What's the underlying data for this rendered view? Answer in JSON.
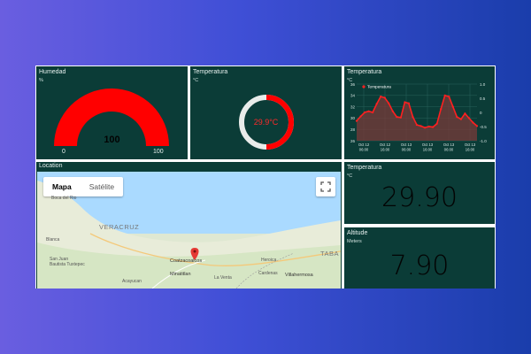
{
  "humedad": {
    "title": "Humedad",
    "unit": "%",
    "value": "100",
    "min": "0",
    "max": "100",
    "fraction": 1.0,
    "color": "#ff0000"
  },
  "temperatura_donut": {
    "title": "Temperatura",
    "unit": "°C",
    "value_text": "29.9°C",
    "fraction": 0.5,
    "color": "#ff0000"
  },
  "temperatura_chart": {
    "title": "Temperatura",
    "unit": "°C",
    "legend": "Temperatura"
  },
  "chart_data": {
    "type": "line",
    "title": "Temperatura",
    "ylabel": "°C",
    "series": [
      {
        "name": "Temperatura",
        "x": [
          0,
          0.3,
          0.6,
          0.9,
          1.2,
          1.5,
          1.8,
          2.1,
          2.4,
          2.7,
          3.0,
          3.3,
          3.6,
          3.9,
          4.2,
          4.5,
          4.8,
          5.1,
          5.4,
          5.7,
          6.0,
          6.3,
          6.6,
          6.9,
          7.2,
          7.5,
          7.8,
          8.1,
          8.4,
          8.7,
          9.0
        ],
        "values": [
          29.5,
          30.3,
          31.0,
          31.2,
          31.0,
          32.5,
          33.8,
          33.6,
          32.6,
          31.2,
          30.2,
          30.1,
          32.8,
          32.6,
          30.2,
          28.8,
          28.6,
          28.3,
          28.5,
          28.4,
          29.0,
          31.6,
          34.0,
          33.8,
          32.0,
          30.2,
          29.8,
          30.8,
          30.0,
          29.2,
          28.6
        ],
        "color": "#ff2020"
      }
    ],
    "categories": [
      "Oct 12\n06:00",
      "Oct 12\n16:00",
      "Oct 13\n06:00",
      "Oct 13\n16:00",
      "Oct 13\n06:00",
      "Oct 13\n16:00"
    ],
    "y_ticks": [
      "26",
      "28",
      "30",
      "32",
      "34",
      "36"
    ],
    "y_right_ticks": [
      "1.0",
      "0.5",
      "0",
      "-0.5",
      "-1.0"
    ],
    "ylim": [
      26,
      36
    ],
    "grid": true,
    "legend_position": "top-left"
  },
  "location": {
    "title": "Location",
    "map_tab": "Mapa",
    "sat_tab": "Satélite",
    "labels": {
      "boca": "Boca del Rio",
      "veracruz": "VERACRUZ",
      "tabasco": "TABA",
      "coatza": "Coatzacoalcos",
      "minatitlan": "Minatitlan",
      "acayucan": "Acayucan",
      "villahermosa": "Villahermosa",
      "cardenas": "Cardenas",
      "heroica": "Heroica",
      "sanjuan": "San Juan Bautista Tuxtepec",
      "blanca": "Blanca",
      "laventa": "La Venta"
    },
    "pin_color": "#e53935"
  },
  "temp_value": {
    "title": "Temperatura",
    "unit": "°C",
    "value": "29.90"
  },
  "altitude": {
    "title": "Altitude",
    "unit": "Meters",
    "value": "7.90"
  },
  "colors": {
    "panel_bg": "#0b3c37",
    "accent_red": "#ff0000",
    "value_text": "#030303"
  }
}
